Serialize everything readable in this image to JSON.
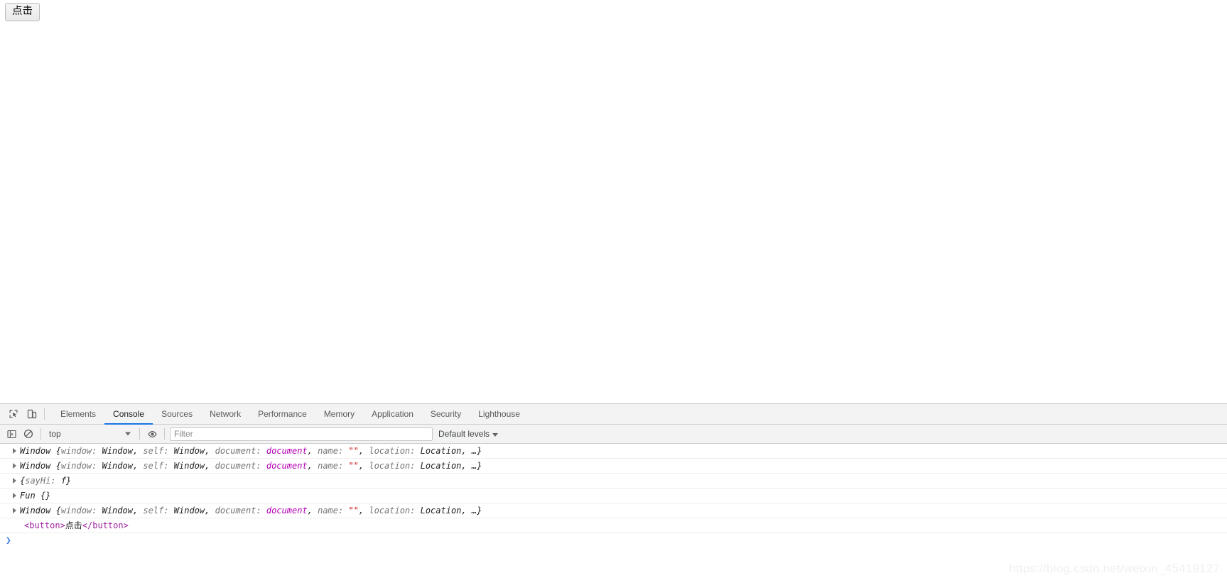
{
  "page": {
    "button_label": "点击"
  },
  "devtools": {
    "tool_icons": [
      {
        "name": "inspect-element-icon",
        "title": "Inspect element"
      },
      {
        "name": "device-toolbar-icon",
        "title": "Toggle device toolbar"
      }
    ],
    "tabs": [
      {
        "label": "Elements",
        "active": false
      },
      {
        "label": "Console",
        "active": true
      },
      {
        "label": "Sources",
        "active": false
      },
      {
        "label": "Network",
        "active": false
      },
      {
        "label": "Performance",
        "active": false
      },
      {
        "label": "Memory",
        "active": false
      },
      {
        "label": "Application",
        "active": false
      },
      {
        "label": "Security",
        "active": false
      },
      {
        "label": "Lighthouse",
        "active": false
      }
    ],
    "active_tab_color": "#1a73e8",
    "console_toolbar": {
      "sidebar_toggle_icon": "console-sidebar-icon",
      "clear_icon": "clear-console-icon",
      "context_value": "top",
      "eye_icon": "live-expression-eye-icon",
      "filter_placeholder": "Filter",
      "filter_value": "",
      "levels_label": "Default levels"
    },
    "messages": [
      {
        "type": "object",
        "expandable": true,
        "parts": [
          {
            "text": "Window ",
            "cls": "t-ctor"
          },
          {
            "text": "{",
            "cls": "t-punct"
          },
          {
            "text": "window: ",
            "cls": "t-key"
          },
          {
            "text": "Window",
            "cls": "t-obj"
          },
          {
            "text": ", ",
            "cls": "t-punct"
          },
          {
            "text": "self: ",
            "cls": "t-key"
          },
          {
            "text": "Window",
            "cls": "t-obj"
          },
          {
            "text": ", ",
            "cls": "t-punct"
          },
          {
            "text": "document: ",
            "cls": "t-key"
          },
          {
            "text": "document",
            "cls": "t-node"
          },
          {
            "text": ", ",
            "cls": "t-punct"
          },
          {
            "text": "name: ",
            "cls": "t-key"
          },
          {
            "text": "\"\"",
            "cls": "t-string"
          },
          {
            "text": ", ",
            "cls": "t-punct"
          },
          {
            "text": "location: ",
            "cls": "t-key"
          },
          {
            "text": "Location",
            "cls": "t-obj"
          },
          {
            "text": ", …}",
            "cls": "t-punct"
          }
        ]
      },
      {
        "type": "object",
        "expandable": true,
        "parts": [
          {
            "text": "Window ",
            "cls": "t-ctor"
          },
          {
            "text": "{",
            "cls": "t-punct"
          },
          {
            "text": "window: ",
            "cls": "t-key"
          },
          {
            "text": "Window",
            "cls": "t-obj"
          },
          {
            "text": ", ",
            "cls": "t-punct"
          },
          {
            "text": "self: ",
            "cls": "t-key"
          },
          {
            "text": "Window",
            "cls": "t-obj"
          },
          {
            "text": ", ",
            "cls": "t-punct"
          },
          {
            "text": "document: ",
            "cls": "t-key"
          },
          {
            "text": "document",
            "cls": "t-node"
          },
          {
            "text": ", ",
            "cls": "t-punct"
          },
          {
            "text": "name: ",
            "cls": "t-key"
          },
          {
            "text": "\"\"",
            "cls": "t-string"
          },
          {
            "text": ", ",
            "cls": "t-punct"
          },
          {
            "text": "location: ",
            "cls": "t-key"
          },
          {
            "text": "Location",
            "cls": "t-obj"
          },
          {
            "text": ", …}",
            "cls": "t-punct"
          }
        ]
      },
      {
        "type": "object",
        "expandable": true,
        "parts": [
          {
            "text": "{",
            "cls": "t-punct"
          },
          {
            "text": "sayHi: ",
            "cls": "t-key"
          },
          {
            "text": "f",
            "cls": "t-obj"
          },
          {
            "text": "}",
            "cls": "t-punct"
          }
        ]
      },
      {
        "type": "object",
        "expandable": true,
        "parts": [
          {
            "text": "Fun ",
            "cls": "t-ctor"
          },
          {
            "text": "{}",
            "cls": "t-punct"
          }
        ]
      },
      {
        "type": "object",
        "expandable": true,
        "parts": [
          {
            "text": "Window ",
            "cls": "t-ctor"
          },
          {
            "text": "{",
            "cls": "t-punct"
          },
          {
            "text": "window: ",
            "cls": "t-key"
          },
          {
            "text": "Window",
            "cls": "t-obj"
          },
          {
            "text": ", ",
            "cls": "t-punct"
          },
          {
            "text": "self: ",
            "cls": "t-key"
          },
          {
            "text": "Window",
            "cls": "t-obj"
          },
          {
            "text": ", ",
            "cls": "t-punct"
          },
          {
            "text": "document: ",
            "cls": "t-key"
          },
          {
            "text": "document",
            "cls": "t-node"
          },
          {
            "text": ", ",
            "cls": "t-punct"
          },
          {
            "text": "name: ",
            "cls": "t-key"
          },
          {
            "text": "\"\"",
            "cls": "t-string"
          },
          {
            "text": ", ",
            "cls": "t-punct"
          },
          {
            "text": "location: ",
            "cls": "t-key"
          },
          {
            "text": "Location",
            "cls": "t-obj"
          },
          {
            "text": ", …}",
            "cls": "t-punct"
          }
        ]
      },
      {
        "type": "html",
        "expandable": false,
        "parts": [
          {
            "text": "<button>",
            "cls": "h-tag"
          },
          {
            "text": "点击",
            "cls": "h-text"
          },
          {
            "text": "</button>",
            "cls": "h-tag"
          }
        ]
      }
    ],
    "prompt_caret": "❯"
  },
  "watermark": "https://blog.csdn.net/weixin_45419127"
}
